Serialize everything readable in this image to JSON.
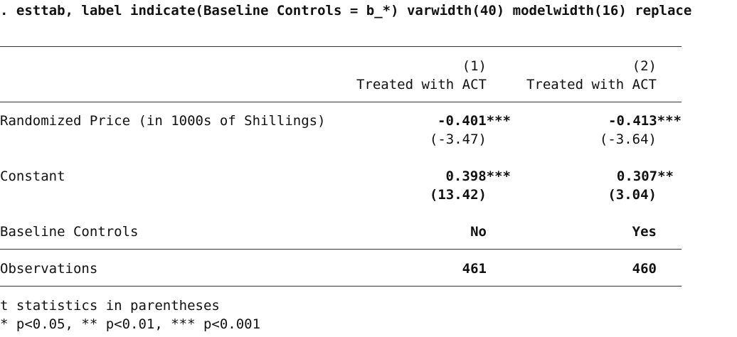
{
  "command": ". esttab, label indicate(Baseline Controls = b_*) varwidth(40) modelwidth(16) replace",
  "header": {
    "col1_num": "(1)",
    "col2_num": "(2)",
    "col1_label": "Treated with ACT",
    "col2_label": "Treated with ACT"
  },
  "rows": [
    {
      "label": "Randomized Price (in 1000s of Shillings)",
      "col1_coef": "-0.401***",
      "col2_coef": "-0.413***",
      "col1_t": "(-3.47)",
      "col2_t": "(-3.64)"
    },
    {
      "label": "Constant",
      "col1_coef": "0.398***",
      "col2_coef": "0.307**",
      "col1_t": "(13.42)",
      "col2_t": "(3.04)"
    }
  ],
  "indicate": {
    "label": "Baseline Controls",
    "col1": "No",
    "col2": "Yes"
  },
  "observations": {
    "label": "Observations",
    "col1": "461",
    "col2": "460"
  },
  "footer": {
    "line1": "t statistics in parentheses",
    "line2": "* p<0.05, ** p<0.01, *** p<0.001"
  }
}
